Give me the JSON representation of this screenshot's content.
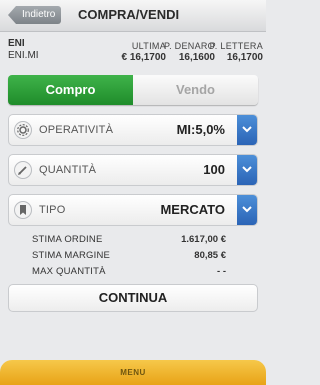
{
  "header": {
    "back_label": "Indietro",
    "title": "COMPRA/VENDI"
  },
  "quote": {
    "symbol": "ENI",
    "symbol_sub": "ENI.MI",
    "cols": [
      {
        "label": "ULTIMA",
        "value": "€ 16,1700"
      },
      {
        "label": "P. DENARO",
        "value": "16,1600"
      },
      {
        "label": "P. LETTERA",
        "value": "16,1700"
      }
    ]
  },
  "side": {
    "buy_label": "Compro",
    "sell_label": "Vendo",
    "selected": "Compro"
  },
  "fields": [
    {
      "label": "OPERATIVITÀ",
      "value": "MI:5,0%",
      "icon": "settings-icon"
    },
    {
      "label": "QUANTITÀ",
      "value": "100",
      "icon": "pencil-icon"
    },
    {
      "label": "TIPO",
      "value": "MERCATO",
      "icon": "bookmark-icon"
    }
  ],
  "summary": [
    {
      "label": "STIMA ORDINE",
      "value": "1.617,00 €"
    },
    {
      "label": "STIMA MARGINE",
      "value": "80,85 €"
    },
    {
      "label": "MAX QUANTITÀ",
      "value": "- -"
    }
  ],
  "continue_label": "CONTINUA",
  "menu_label": "MENU",
  "colors": {
    "accent_green": "#2a9d35",
    "dropdown_blue": "#3474c4",
    "menu_yellow": "#f0b52a"
  }
}
